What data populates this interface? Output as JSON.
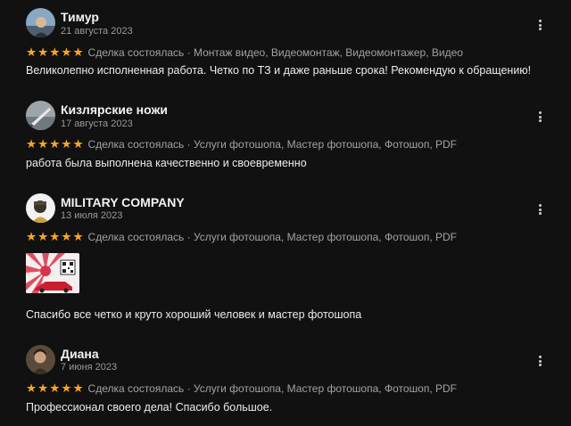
{
  "reviews": [
    {
      "author": "Тимур",
      "date": "21 августа 2023",
      "stars": 5,
      "deal_text": "Сделка состоялась · Монтаж видео, Видеомонтаж, Видеомонтажер, Видео",
      "body": "Великолепно исполненная работа. Четко по ТЗ и даже раньше срока! Рекомендую к обращению!",
      "avatar_icon": "avatar-photo"
    },
    {
      "author": "Кизлярские ножи",
      "date": "17 августа 2023",
      "stars": 5,
      "deal_text": "Сделка состоялась · Услуги фотошопа, Мастер фотошопа, Фотошоп, PDF",
      "body": "работа была выполнена качественно и своевременно",
      "avatar_icon": "knife-avatar"
    },
    {
      "author": "MILITARY COMPANY",
      "date": "13 июля 2023",
      "stars": 5,
      "deal_text": "Сделка состоялась · Услуги фотошопа, Мастер фотошопа, Фотошоп, PDF",
      "body": "Спасибо все четко и круто хороший человек и мастер фотошопа",
      "avatar_icon": "soldier-avatar",
      "has_attachment": true
    },
    {
      "author": "Диана",
      "date": "7 июня 2023",
      "stars": 5,
      "deal_text": "Сделка состоялась · Услуги фотошопа, Мастер фотошопа, Фотошоп, PDF",
      "body": "Профессионал своего дела! Спасибо большое.",
      "avatar_icon": "avatar-photo"
    }
  ],
  "star_glyph": "★",
  "colors": {
    "background": "#111111",
    "star": "#f5a623",
    "muted_text": "#9a9a9a"
  }
}
